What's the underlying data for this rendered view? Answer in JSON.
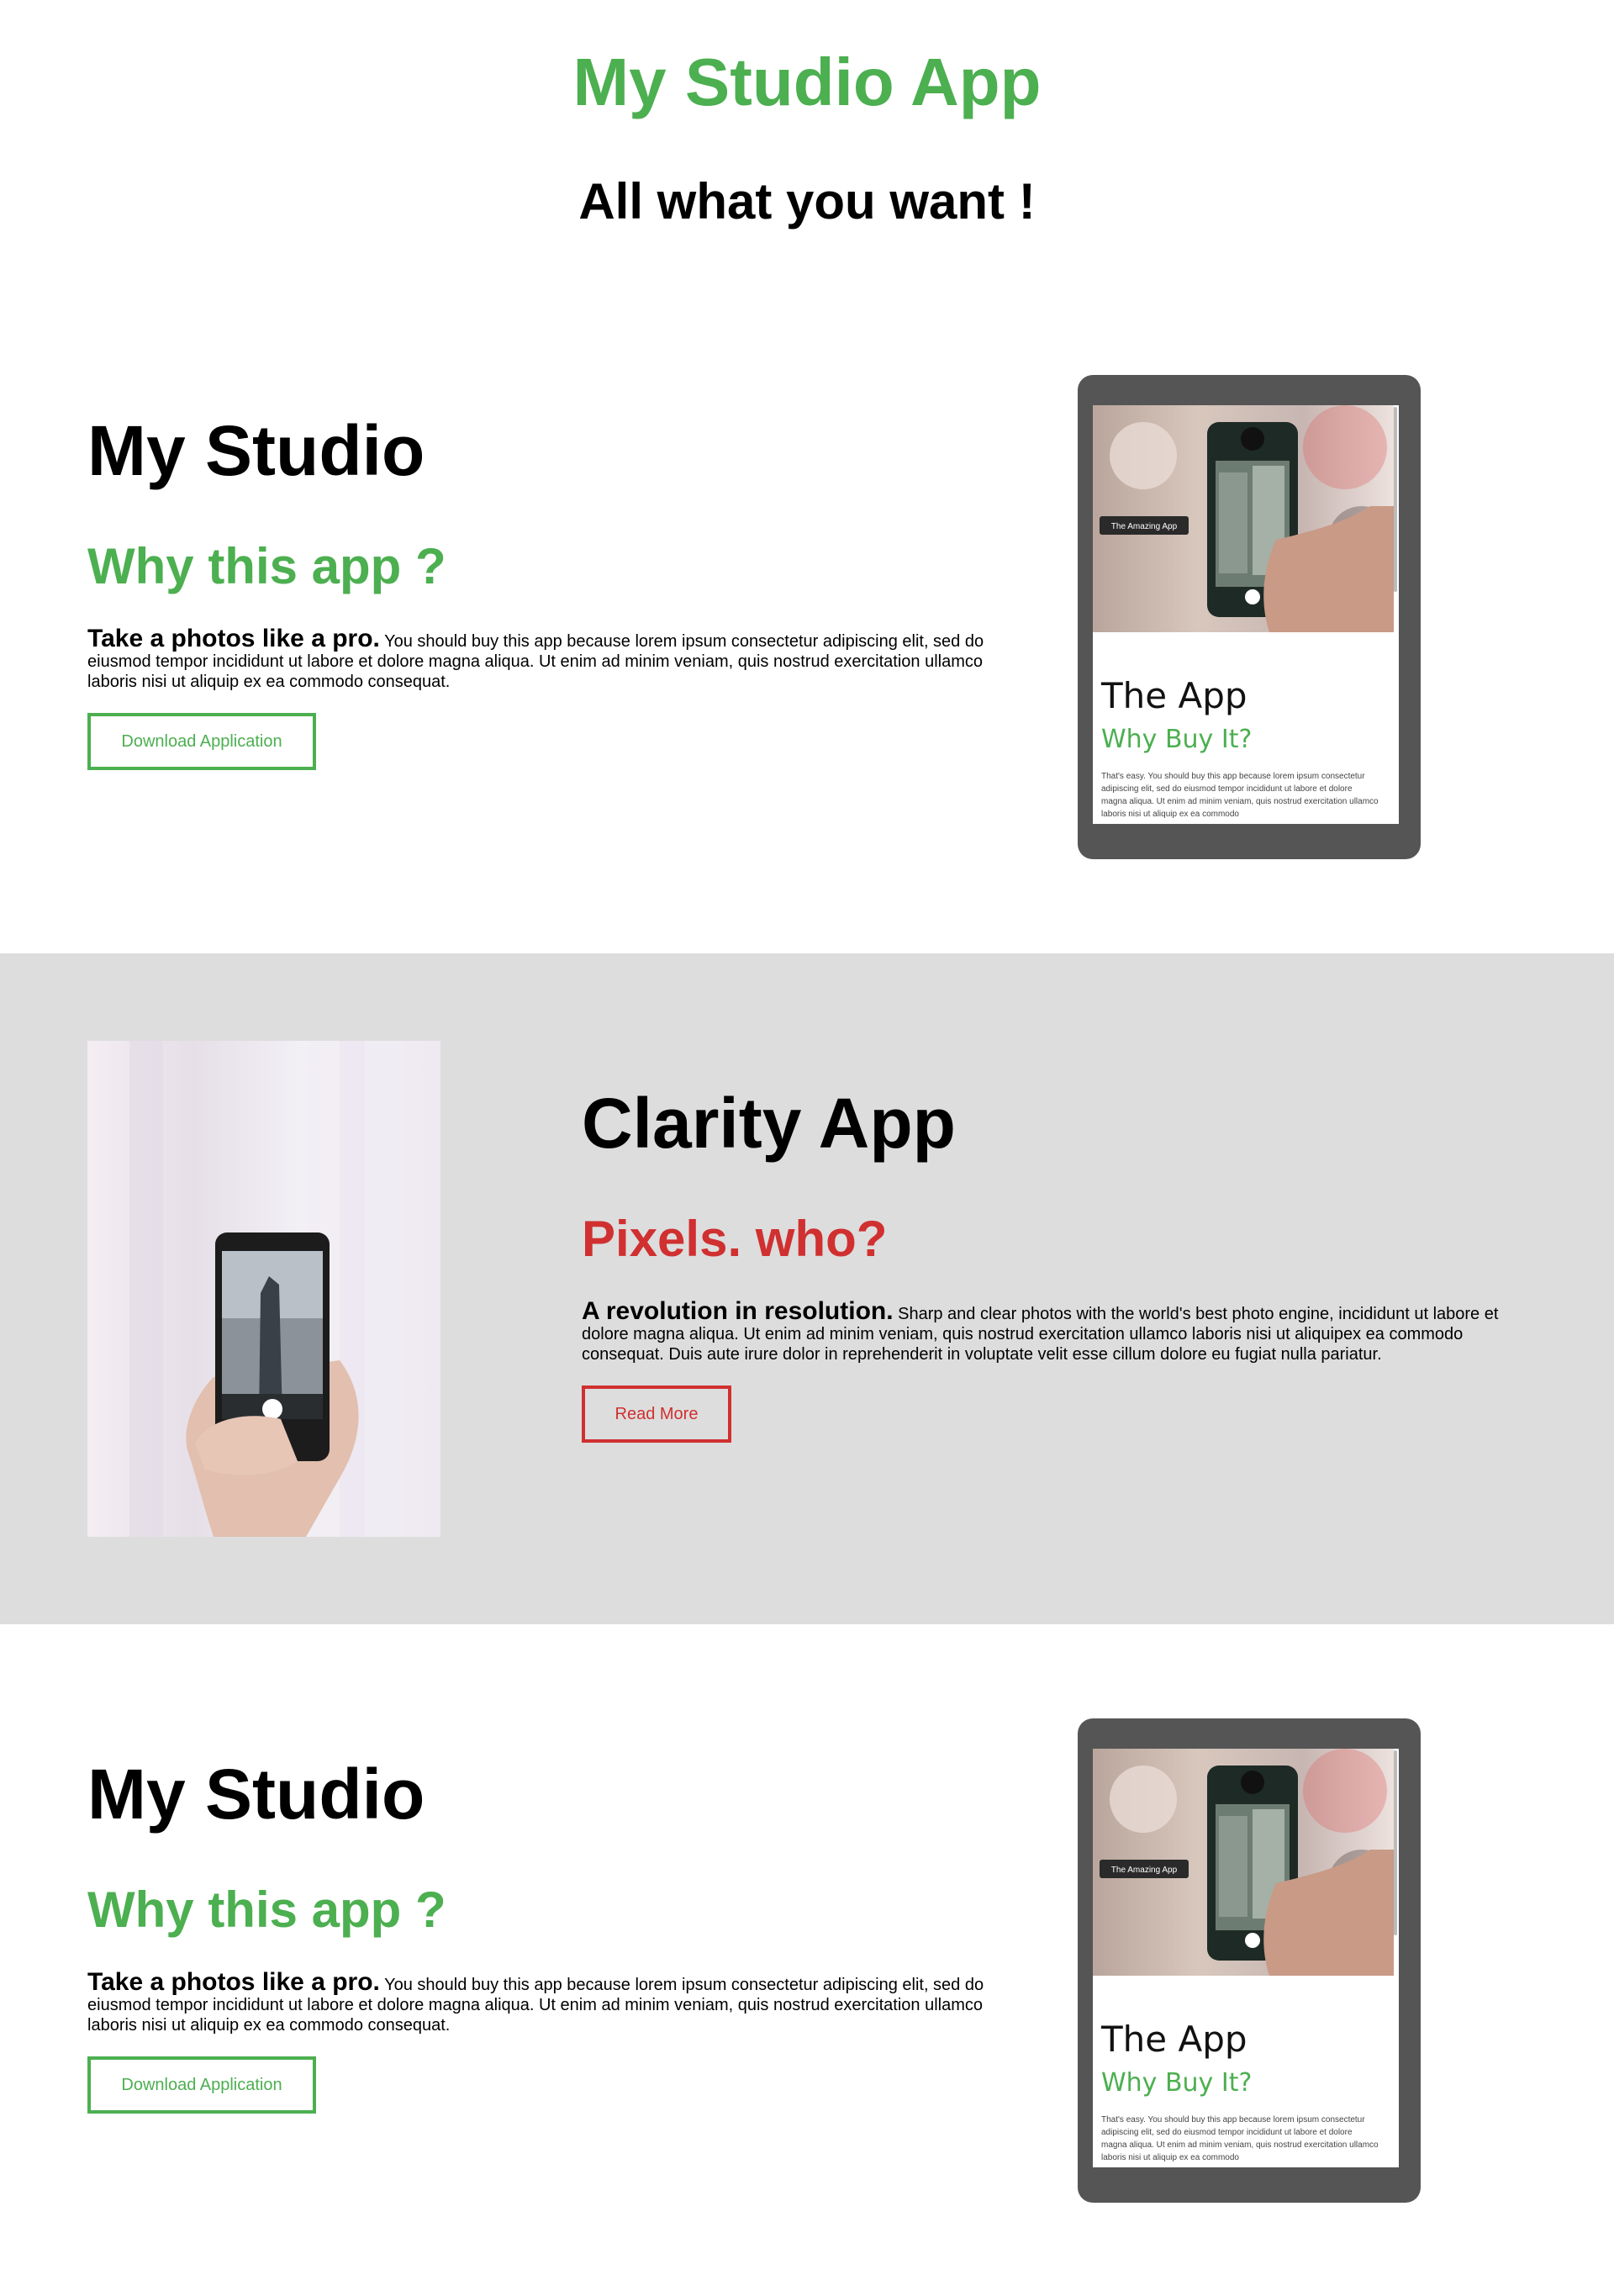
{
  "header": {
    "title": "My Studio App",
    "tagline": "All what you want !"
  },
  "sections": [
    {
      "title": "My Studio",
      "subtitle": "Why this app ?",
      "lead": "Take a photos like a pro.",
      "text": "You should buy this app because lorem ipsum consectetur adipiscing elit, sed do eiusmod tempor incididunt ut labore et dolore magna aliqua. Ut enim ad minim veniam, quis nostrud exercitation ullamco laboris nisi ut aliquip ex ea commodo consequat.",
      "button": "Download Application"
    },
    {
      "title": "Clarity App",
      "subtitle": "Pixels. who?",
      "lead": "A revolution in resolution.",
      "text": "Sharp and clear photos with the world's best photo engine, incididunt ut labore et dolore magna aliqua. Ut enim ad minim veniam, quis nostrud exercitation ullamco laboris nisi ut aliquipex ea commodo consequat. Duis aute irure dolor in reprehenderit in voluptate velit esse cillum dolore eu fugiat nulla pariatur.",
      "button": "Read More"
    },
    {
      "title": "My Studio",
      "subtitle": "Why this app ?",
      "lead": "Take a photos like a pro.",
      "text": "You should buy this app because lorem ipsum consectetur adipiscing elit, sed do eiusmod tempor incididunt ut labore et dolore magna aliqua. Ut enim ad minim veniam, quis nostrud exercitation ullamco laboris nisi ut aliquip ex ea commodo consequat.",
      "button": "Download Application"
    }
  ],
  "tablet": {
    "badge": "The Amazing App",
    "title": "The App",
    "subtitle": "Why Buy It?",
    "text": "That's easy. You should buy this app because lorem ipsum consectetur adipiscing elit, sed do eiusmod tempor incididunt ut labore et dolore magna aliqua. Ut enim ad minim veniam, quis nostrud exercitation ullamco laboris nisi ut aliquip ex ea commodo"
  },
  "colors": {
    "accent_green": "#4caf50",
    "accent_red": "#d03030",
    "band_gray": "#dddddd",
    "tablet_frame": "#555555"
  },
  "icons": [
    "tablet-mockup",
    "phone-photo"
  ]
}
